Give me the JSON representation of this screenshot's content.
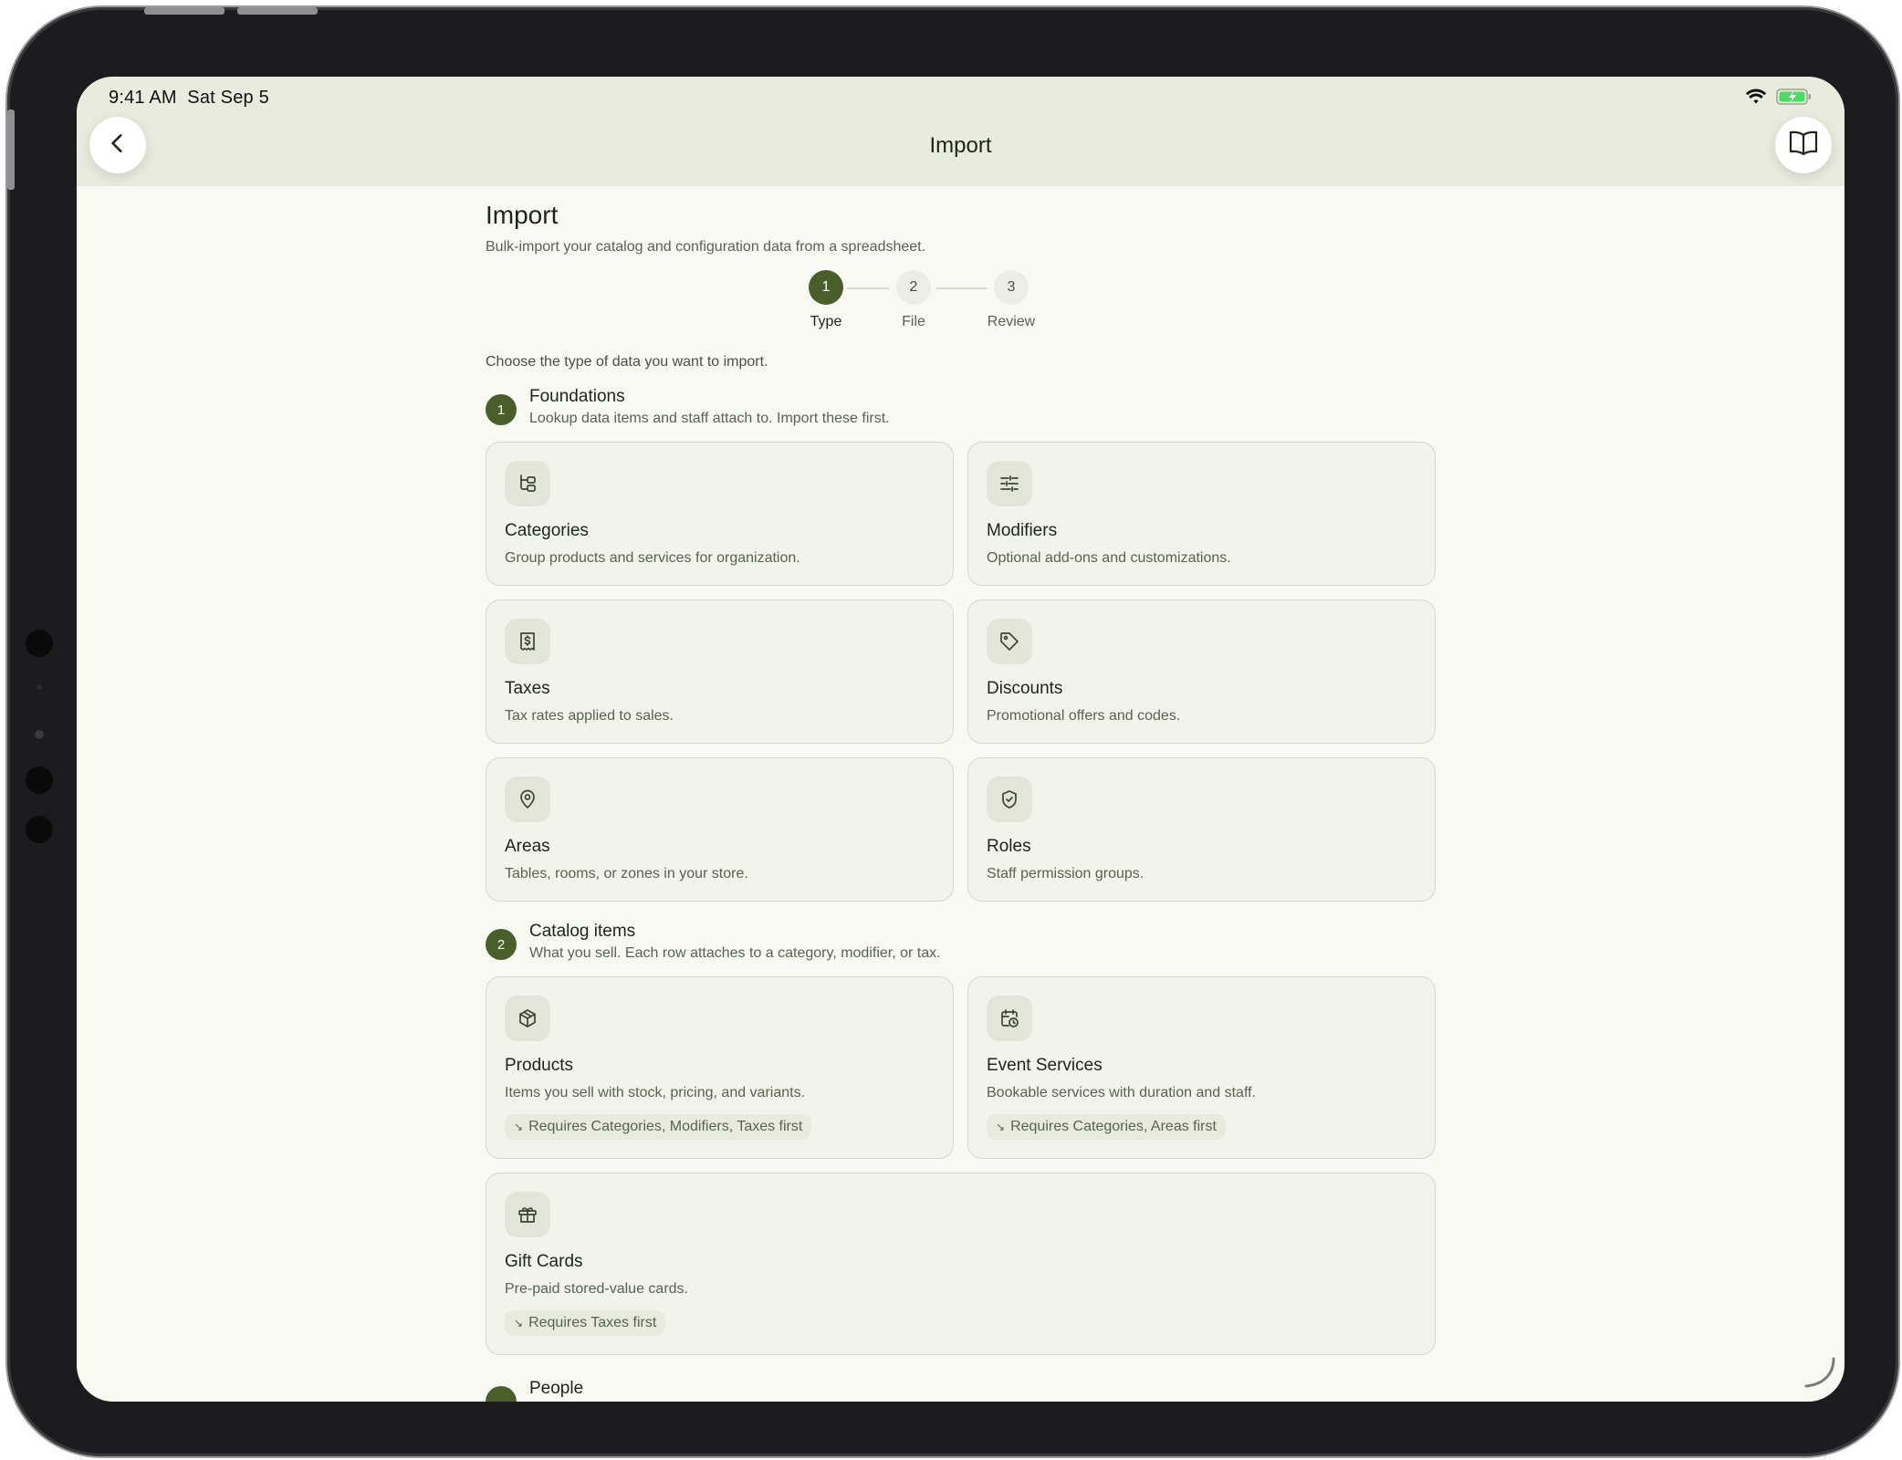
{
  "status": {
    "time": "9:41 AM",
    "date": "Sat Sep 5"
  },
  "nav": {
    "title": "Import"
  },
  "page": {
    "title": "Import",
    "subtitle": "Bulk-import your catalog and configuration data from a spreadsheet.",
    "prompt": "Choose the type of data you want to import."
  },
  "stepper": {
    "steps": [
      {
        "number": "1",
        "label": "Type"
      },
      {
        "number": "2",
        "label": "File"
      },
      {
        "number": "3",
        "label": "Review"
      }
    ]
  },
  "sections": [
    {
      "number": "1",
      "title": "Foundations",
      "description": "Lookup data items and staff attach to. Import these first.",
      "cards": [
        {
          "title": "Categories",
          "description": "Group products and services for organization.",
          "icon": "categories-icon"
        },
        {
          "title": "Modifiers",
          "description": "Optional add-ons and customizations.",
          "icon": "sliders-icon"
        },
        {
          "title": "Taxes",
          "description": "Tax rates applied to sales.",
          "icon": "receipt-icon"
        },
        {
          "title": "Discounts",
          "description": "Promotional offers and codes.",
          "icon": "tag-icon"
        },
        {
          "title": "Areas",
          "description": "Tables, rooms, or zones in your store.",
          "icon": "map-pin-icon"
        },
        {
          "title": "Roles",
          "description": "Staff permission groups.",
          "icon": "shield-check-icon"
        }
      ]
    },
    {
      "number": "2",
      "title": "Catalog items",
      "description": "What you sell. Each row attaches to a category, modifier, or tax.",
      "cards": [
        {
          "title": "Products",
          "description": "Items you sell with stock, pricing, and variants.",
          "requires": "Requires Categories, Modifiers, Taxes first",
          "icon": "box-icon"
        },
        {
          "title": "Event Services",
          "description": "Bookable services with duration and staff.",
          "requires": "Requires Categories, Areas first",
          "icon": "calendar-clock-icon"
        },
        {
          "title": "Gift Cards",
          "description": "Pre-paid stored-value cards.",
          "requires": "Requires Taxes first",
          "icon": "gift-icon"
        }
      ]
    }
  ],
  "next_section": {
    "title": "People"
  },
  "colors": {
    "accent": "#4a5e2c",
    "background": "#f9f9f4",
    "card": "#f2f3eb",
    "navbar": "#e9ebdf"
  }
}
